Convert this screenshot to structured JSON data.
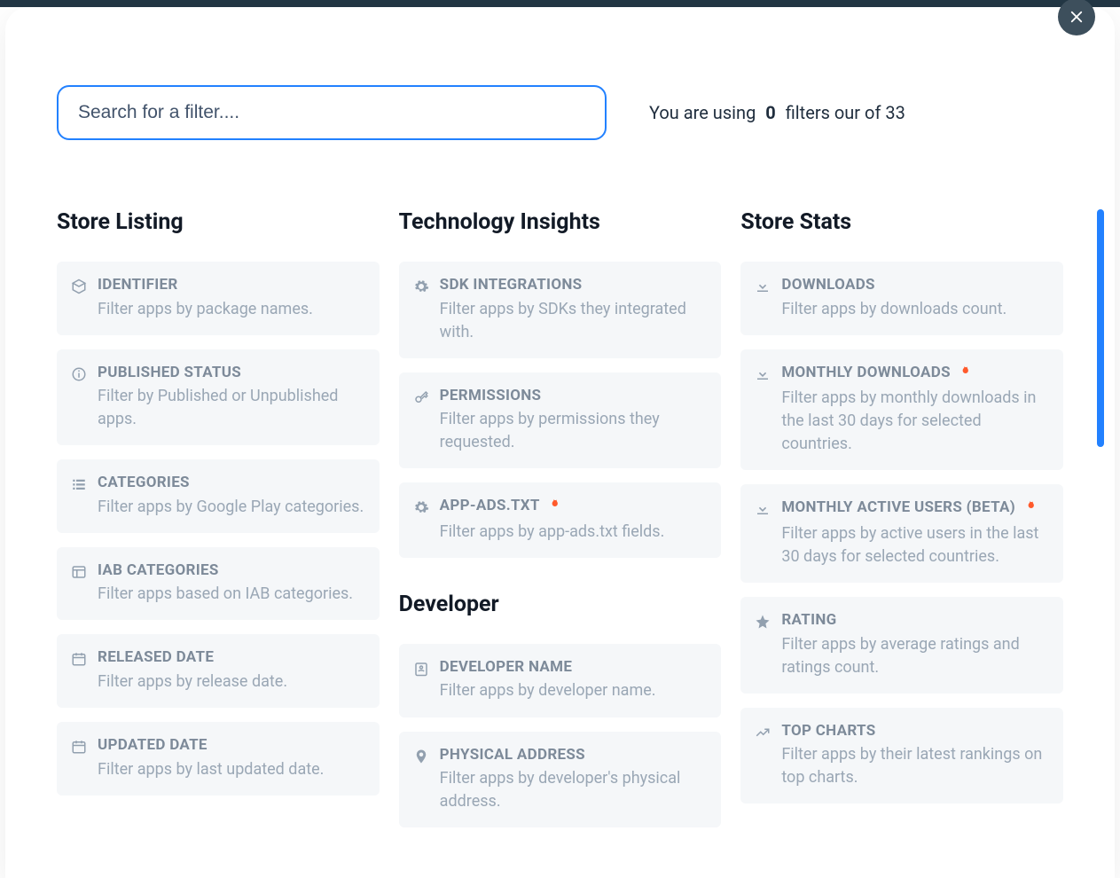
{
  "search": {
    "placeholder": "Search for a filter...."
  },
  "summary": {
    "prefix": "You are using",
    "count": "0",
    "suffix": "filters our of 33"
  },
  "columns": {
    "store_listing": {
      "title": "Store Listing",
      "items": [
        {
          "title": "IDENTIFIER",
          "desc": "Filter apps by package names.",
          "icon": "box"
        },
        {
          "title": "PUBLISHED STATUS",
          "desc": "Filter by Published or Unpublished apps.",
          "icon": "info"
        },
        {
          "title": "CATEGORIES",
          "desc": "Filter apps by Google Play categories.",
          "icon": "list"
        },
        {
          "title": "IAB CATEGORIES",
          "desc": "Filter apps based on IAB categories.",
          "icon": "grid"
        },
        {
          "title": "RELEASED DATE",
          "desc": "Filter apps by release date.",
          "icon": "calendar"
        },
        {
          "title": "UPDATED DATE",
          "desc": "Filter apps by last updated date.",
          "icon": "calendar"
        }
      ]
    },
    "technology_insights": {
      "title": "Technology Insights",
      "items": [
        {
          "title": "SDK INTEGRATIONS",
          "desc": "Filter apps by SDKs they integrated with.",
          "icon": "gear"
        },
        {
          "title": "PERMISSIONS",
          "desc": "Filter apps by permissions they requested.",
          "icon": "key"
        },
        {
          "title": "APP-ADS.TXT",
          "desc": "Filter apps by app-ads.txt fields.",
          "icon": "gear",
          "hot": true
        }
      ]
    },
    "developer": {
      "title": "Developer",
      "items": [
        {
          "title": "DEVELOPER NAME",
          "desc": "Filter apps by developer name.",
          "icon": "id"
        },
        {
          "title": "PHYSICAL ADDRESS",
          "desc": "Filter apps by developer's physical address.",
          "icon": "pin"
        }
      ]
    },
    "store_stats": {
      "title": "Store Stats",
      "items": [
        {
          "title": "DOWNLOADS",
          "desc": "Filter apps by downloads count.",
          "icon": "download"
        },
        {
          "title": "MONTHLY DOWNLOADS",
          "desc": "Filter apps by monthly downloads in the last 30 days for selected countries.",
          "icon": "download",
          "hot": true
        },
        {
          "title": "MONTHLY ACTIVE USERS (BETA)",
          "desc": "Filter apps by active users in the last 30 days for selected countries.",
          "icon": "download",
          "hot": true
        },
        {
          "title": "RATING",
          "desc": "Filter apps by average ratings and ratings count.",
          "icon": "star"
        },
        {
          "title": "TOP CHARTS",
          "desc": "Filter apps by their latest rankings on top charts.",
          "icon": "chart"
        }
      ]
    }
  }
}
